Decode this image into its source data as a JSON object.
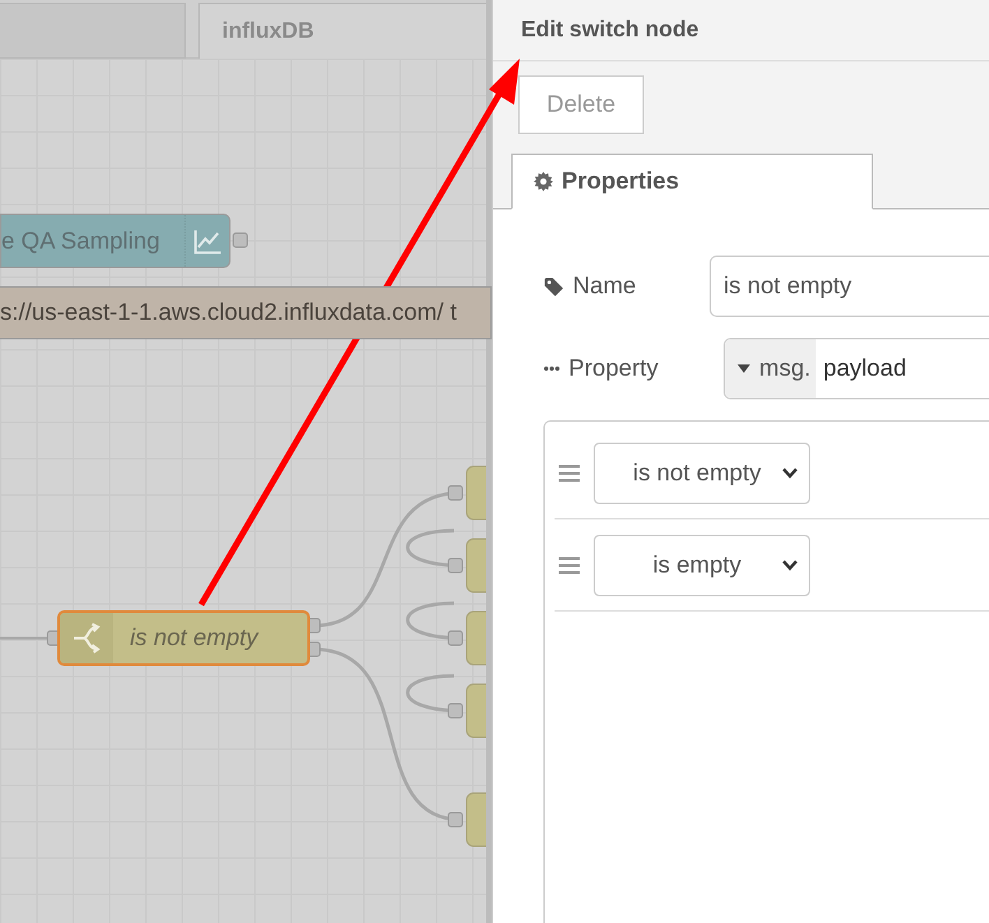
{
  "workspace": {
    "tabs": [
      {
        "label": "influxDB",
        "selected": true
      }
    ],
    "nodes": [
      {
        "kind": "chart",
        "label": "e QA Sampling",
        "selected": false
      },
      {
        "kind": "comment",
        "label": "s://us-east-1-1.aws.cloud2.influxdata.com/ t",
        "selected": false
      },
      {
        "kind": "switch",
        "label": "is not empty",
        "selected": true
      }
    ]
  },
  "panel": {
    "title": "Edit switch node",
    "buttons": [
      "Delete"
    ],
    "tabs": [
      {
        "label": "Properties",
        "selected": true
      }
    ],
    "name": {
      "label": "Name",
      "value": "is not empty"
    },
    "property": {
      "label": "Property",
      "type": "msg.",
      "value": "payload"
    },
    "rules": [
      {
        "value": "is not empty"
      },
      {
        "value": "is empty"
      }
    ]
  }
}
